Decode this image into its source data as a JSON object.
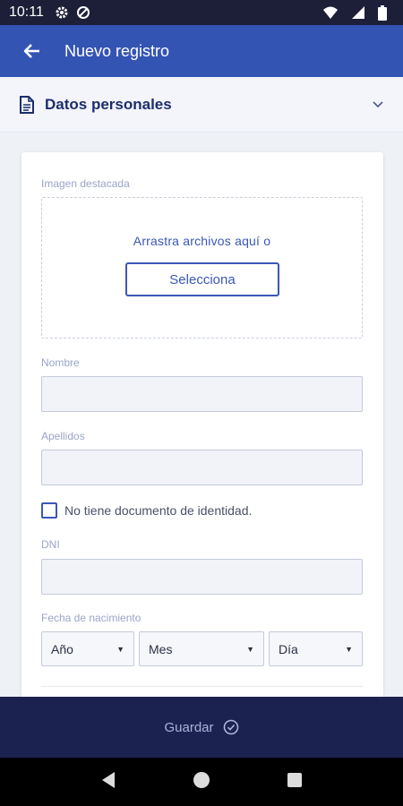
{
  "status": {
    "time": "10:11",
    "icons": [
      "gear-icon",
      "data-saver-icon",
      "wifi-icon",
      "signal-icon",
      "battery-icon"
    ]
  },
  "appbar": {
    "title": "Nuevo registro",
    "back_icon": "arrow-back-icon"
  },
  "section": {
    "title": "Datos personales",
    "icon": "document-icon",
    "expand_icon": "chevron-down-icon"
  },
  "form": {
    "image_label": "Imagen destacada",
    "dropzone_text": "Arrastra archivos aquí o",
    "select_button": "Selecciona",
    "name_label": "Nombre",
    "name_value": "",
    "surname_label": "Apellidos",
    "surname_value": "",
    "no_id_label": "No tiene documento de identidad.",
    "no_id_checked": false,
    "dni_label": "DNI",
    "dni_value": "",
    "birth_label": "Fecha de nacimiento",
    "year_select": "Año",
    "month_select": "Mes",
    "day_select": "Día"
  },
  "footer": {
    "save_label": "Guardar",
    "save_icon": "check-circle-icon"
  },
  "colors": {
    "appbar": "#3454b4",
    "accent": "#3b57b8",
    "footer": "#1c2250",
    "section_title": "#1d2d6e"
  }
}
